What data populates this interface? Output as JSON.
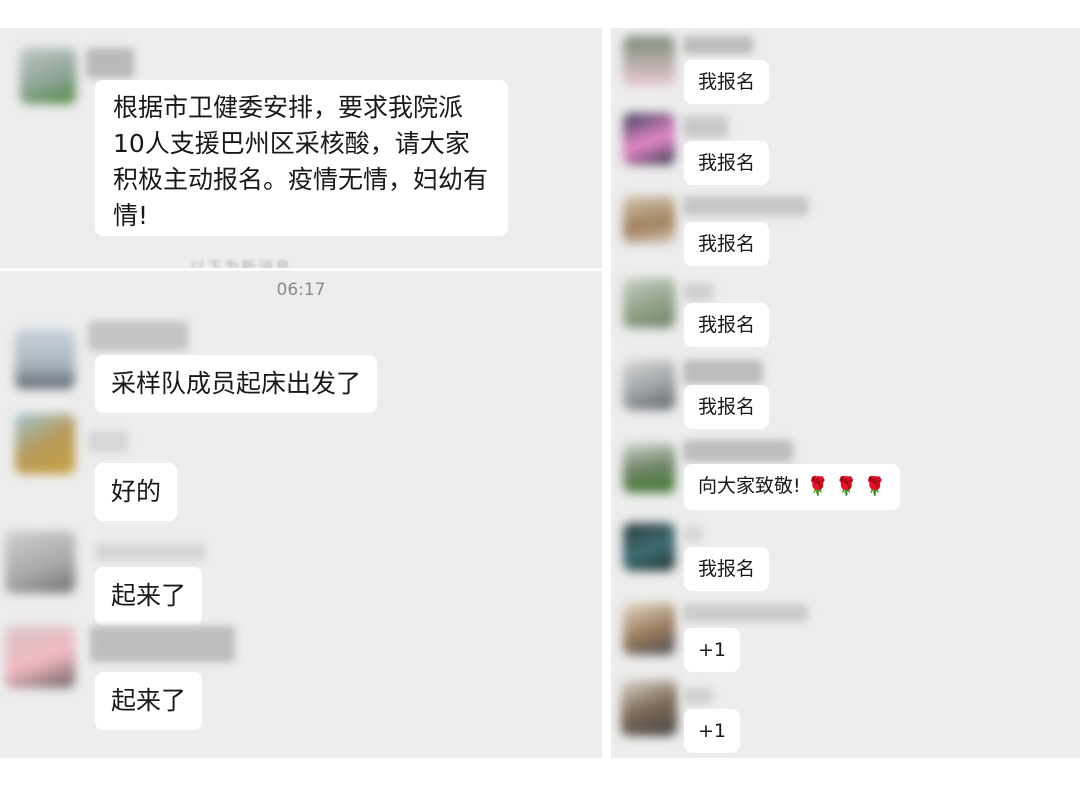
{
  "top_panel": {
    "announcement": "根据市卫健委安排，要求我院派10人支援巴州区采核酸，请大家积极主动报名。疫情无情，妇幼有情!",
    "cutoff_text": "以下为新消息"
  },
  "bottom_panel": {
    "timestamp": "06:17",
    "messages": [
      {
        "text": "采样队成员起床出发了"
      },
      {
        "text": "好的"
      },
      {
        "text": "起来了"
      },
      {
        "text": "起来了"
      }
    ]
  },
  "right_panel": {
    "messages": [
      {
        "text": "我报名"
      },
      {
        "text": "我报名"
      },
      {
        "text": "我报名"
      },
      {
        "text": "我报名"
      },
      {
        "text": "我报名"
      },
      {
        "text": "向大家致敬!",
        "emoji": "rose-icon ×3"
      },
      {
        "text": "我报名"
      },
      {
        "text": "+1"
      },
      {
        "text": "+1"
      }
    ]
  },
  "colors": {
    "chat_background": "#ededed",
    "bubble_background": "#ffffff",
    "text": "#191919",
    "timestamp": "#8a8a8a",
    "rose": "#d9342b"
  }
}
